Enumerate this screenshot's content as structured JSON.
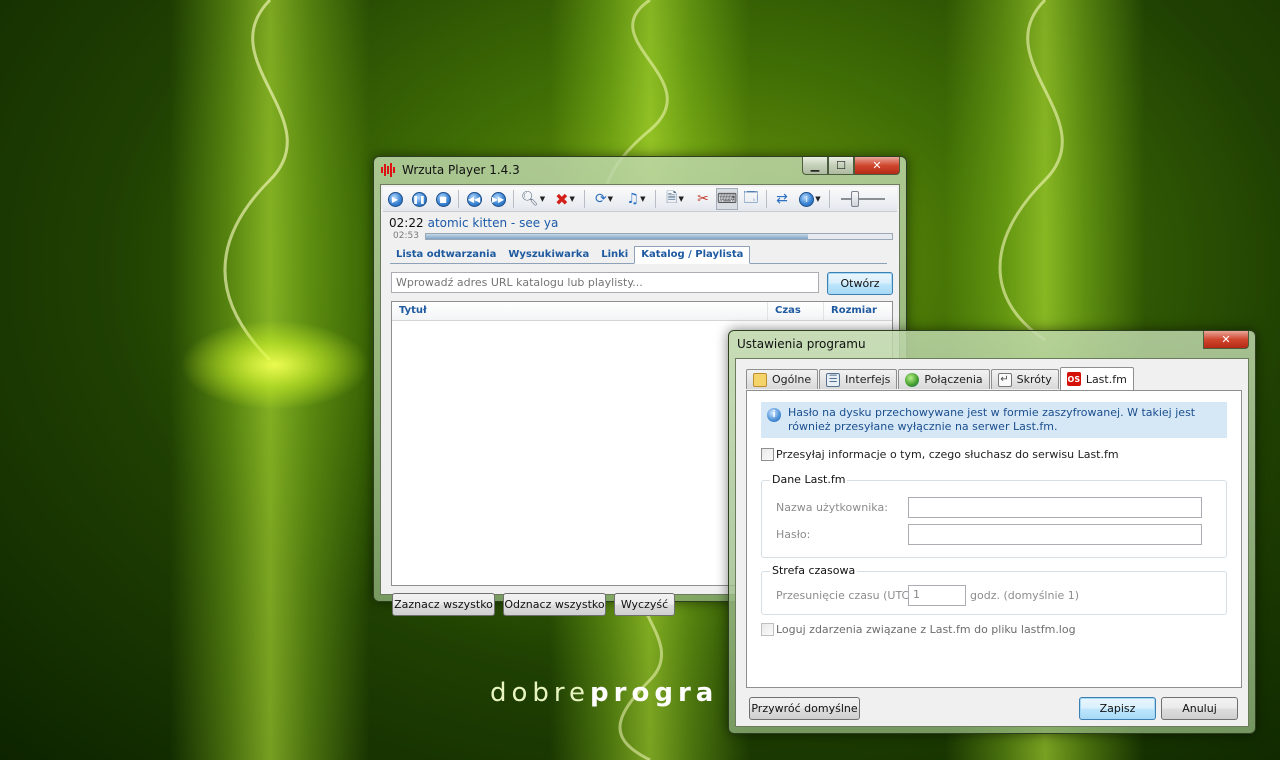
{
  "desktop": {
    "brand_light": "dobre",
    "brand_bold": "progra"
  },
  "player": {
    "title": "Wrzuta Player 1.4.3",
    "window_buttons": {
      "minimize": "▁",
      "maximize": "☐",
      "close": "✕"
    },
    "now_time": "02:22",
    "now_track": "atomic kitten - see ya",
    "total_time": "02:53",
    "progress_fraction": 0.82,
    "tabs": [
      "Lista odtwarzania",
      "Wyszukiwarka",
      "Linki",
      "Katalog / Playlista"
    ],
    "active_tab": 3,
    "url_placeholder": "Wprowadź adres URL katalogu lub playlisty...",
    "open_button": "Otwórz",
    "columns": [
      "Tytuł",
      "Czas",
      "Rozmiar"
    ],
    "buttons": {
      "select_all": "Zaznacz wszystko",
      "deselect_all": "Odznacz wszystko",
      "clear": "Wyczyść"
    }
  },
  "settings": {
    "title": "Ustawienia programu",
    "close": "✕",
    "tabs": [
      "Ogólne",
      "Interfejs",
      "Połączenia",
      "Skróty",
      "Last.fm"
    ],
    "lastfm_icon_text": "OS",
    "info_text": "Hasło na dysku przechowywane jest w formie zaszyfrowanej. W takiej jest również przesyłane wyłącznie na serwer Last.fm.",
    "scrobble_label": "Przesyłaj informacje o tym, czego słuchasz do serwisu Last.fm",
    "group_account": "Dane Last.fm",
    "username_label": "Nazwa użytkownika:",
    "password_label": "Hasło:",
    "username_value": "",
    "password_value": "",
    "group_timezone": "Strefa czasowa",
    "offset_label": "Przesunięcie czasu (UTC):",
    "offset_value": "1",
    "offset_suffix": "godz. (domyślnie 1)",
    "log_label": "Loguj zdarzenia związane z Last.fm do pliku lastfm.log",
    "buttons": {
      "restore": "Przywróć domyślne",
      "save": "Zapisz",
      "cancel": "Anuluj"
    }
  },
  "colors": {
    "accent_blue": "#1f5aa0",
    "info_bg": "#d6e8f6",
    "close_red": "#c9371e"
  }
}
